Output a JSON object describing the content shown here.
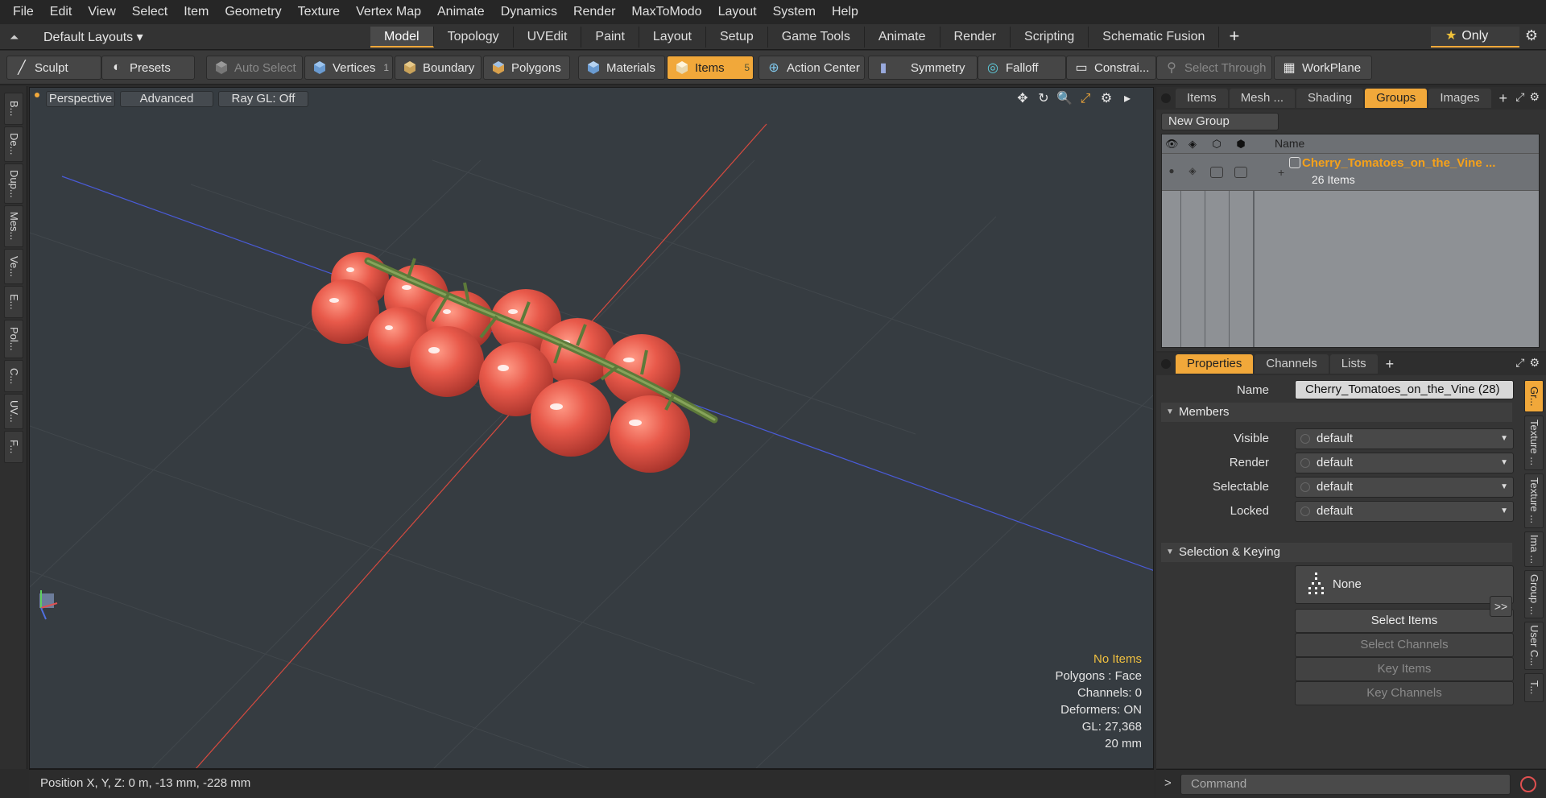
{
  "menu": [
    "File",
    "Edit",
    "View",
    "Select",
    "Item",
    "Geometry",
    "Texture",
    "Vertex Map",
    "Animate",
    "Dynamics",
    "Render",
    "MaxToModo",
    "Layout",
    "System",
    "Help"
  ],
  "layout_bar": {
    "layouts_label": "Default Layouts ▾",
    "tabs": [
      "Model",
      "Topology",
      "UVEdit",
      "Paint",
      "Layout",
      "Setup",
      "Game Tools",
      "Animate",
      "Render",
      "Scripting",
      "Schematic Fusion"
    ],
    "active_tab": "Model",
    "only_label": "Only"
  },
  "toolbar": {
    "sculpt": "Sculpt",
    "presets": "Presets",
    "auto_select": "Auto Select",
    "vertices": "Vertices",
    "vertices_count": "1",
    "boundary": "Boundary",
    "polygons": "Polygons",
    "materials": "Materials",
    "items": "Items",
    "items_count": "5",
    "action_center": "Action Center",
    "symmetry": "Symmetry",
    "falloff": "Falloff",
    "constraints": "Constrai...",
    "select_through": "Select Through",
    "workplane": "WorkPlane"
  },
  "left_strip": [
    "B...",
    "De...",
    "Dup...",
    "Mes...",
    "Ve...",
    "E...",
    "Pol...",
    "C...",
    "UV...",
    "F..."
  ],
  "viewport": {
    "view_label": "Perspective",
    "advanced_label": "Advanced",
    "raygl_label": "Ray GL: Off",
    "info": {
      "no_items": "No Items",
      "polygons": "Polygons : Face",
      "channels": "Channels: 0",
      "deformers": "Deformers: ON",
      "gl": "GL: 27,368",
      "scale": "20 mm"
    }
  },
  "status": {
    "position": "Position X, Y, Z:  0 m, -13 mm, -228 mm"
  },
  "top_panel": {
    "tabs": [
      "Items",
      "Mesh ...",
      "Shading",
      "Groups",
      "Images"
    ],
    "active_tab": "Groups",
    "new_group": "New Group",
    "header_name": "Name",
    "group_name": "Cherry_Tomatoes_on_the_Vine ...",
    "group_count": "26 Items"
  },
  "properties": {
    "tabs": [
      "Properties",
      "Channels",
      "Lists"
    ],
    "active_tab": "Properties",
    "name_label": "Name",
    "name_value": "Cherry_Tomatoes_on_the_Vine (28)",
    "members_section": "Members",
    "visible_label": "Visible",
    "visible_value": "default",
    "render_label": "Render",
    "render_value": "default",
    "selectable_label": "Selectable",
    "selectable_value": "default",
    "locked_label": "Locked",
    "locked_value": "default",
    "selection_section": "Selection & Keying",
    "none_label": "None",
    "select_items": "Select Items",
    "select_channels": "Select Channels",
    "key_items": "Key Items",
    "key_channels": "Key Channels",
    "more": ">>"
  },
  "right_strip": [
    "Gr...",
    "Texture ...",
    "Texture ...",
    "Ima ...",
    "Group ...",
    "User C...",
    "T..."
  ],
  "command": {
    "placeholder": "Command"
  }
}
